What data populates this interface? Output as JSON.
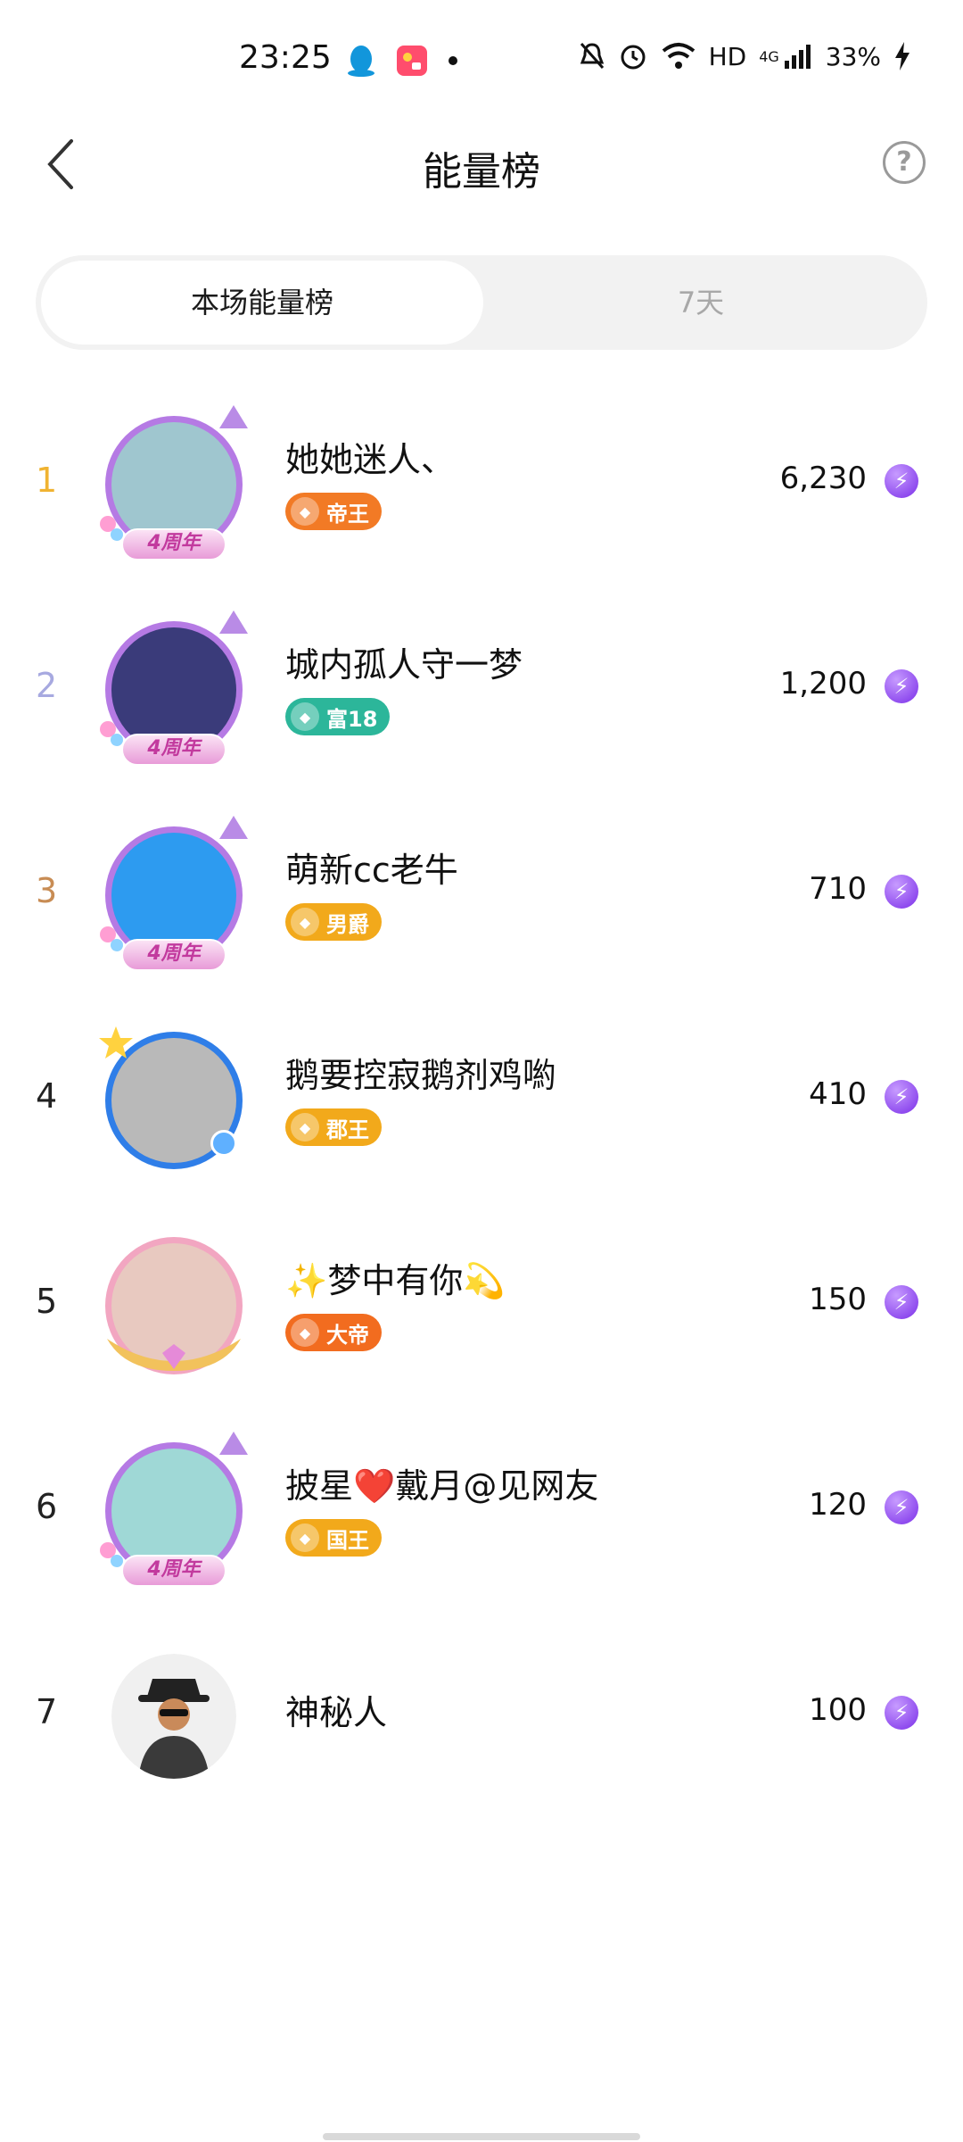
{
  "status_bar": {
    "time": "23:25",
    "network": "HD",
    "signal": "4G",
    "battery": "33%",
    "icons": [
      "qq-icon",
      "app-icon",
      "dot-icon",
      "mute-icon",
      "alarm-icon",
      "wifi-icon",
      "signal-icon",
      "charging-icon"
    ]
  },
  "header": {
    "title": "能量榜",
    "help_glyph": "?"
  },
  "tabs": [
    {
      "label": "本场能量榜",
      "active": true
    },
    {
      "label": "7天",
      "active": false
    }
  ],
  "frame_badge_text": "4周年",
  "rows": [
    {
      "rank": "1",
      "rank_color": "#f0b331",
      "name": "她她迷人、",
      "badge": "帝王",
      "badge_color": "#f27a25",
      "score": "6,230",
      "avatar_bg": "#9fc6cf",
      "ring": "#b57ae4"
    },
    {
      "rank": "2",
      "rank_color": "#a7a9e0",
      "name": "城内孤人守一梦",
      "badge": "富18",
      "badge_color": "#2cb69a",
      "score": "1,200",
      "avatar_bg": "#3a3b7a",
      "ring": "#b57ae4"
    },
    {
      "rank": "3",
      "rank_color": "#c88c54",
      "name": "萌新cc老牛",
      "badge": "男爵",
      "badge_color": "#f2a91b",
      "score": "710",
      "avatar_bg": "#2d9bf0",
      "ring": "#b57ae4"
    },
    {
      "rank": "4",
      "rank_color": "#222222",
      "name": "鹅要控寂鹅剂鸡喲",
      "badge": "郡王",
      "badge_color": "#f2a91b",
      "score": "410",
      "avatar_bg": "#b9b9b9",
      "ring": "#2f7ee8"
    },
    {
      "rank": "5",
      "rank_color": "#222222",
      "name": "✨梦中有你💫",
      "badge": "大帝",
      "badge_color": "#f26c1f",
      "score": "150",
      "avatar_bg": "#e8c9c0",
      "ring": "#f2a6c1"
    },
    {
      "rank": "6",
      "rank_color": "#222222",
      "name": "披星❤️戴月@见网友",
      "badge": "国王",
      "badge_color": "#f2a91b",
      "score": "120",
      "avatar_bg": "#9fd8d6",
      "ring": "#b57ae4"
    },
    {
      "rank": "7",
      "rank_color": "#222222",
      "name": "神秘人",
      "badge": "",
      "badge_color": "",
      "score": "100",
      "avatar_bg": "#f0f0f0",
      "ring": "#ffffff"
    }
  ],
  "energy_glyph": "⚡"
}
